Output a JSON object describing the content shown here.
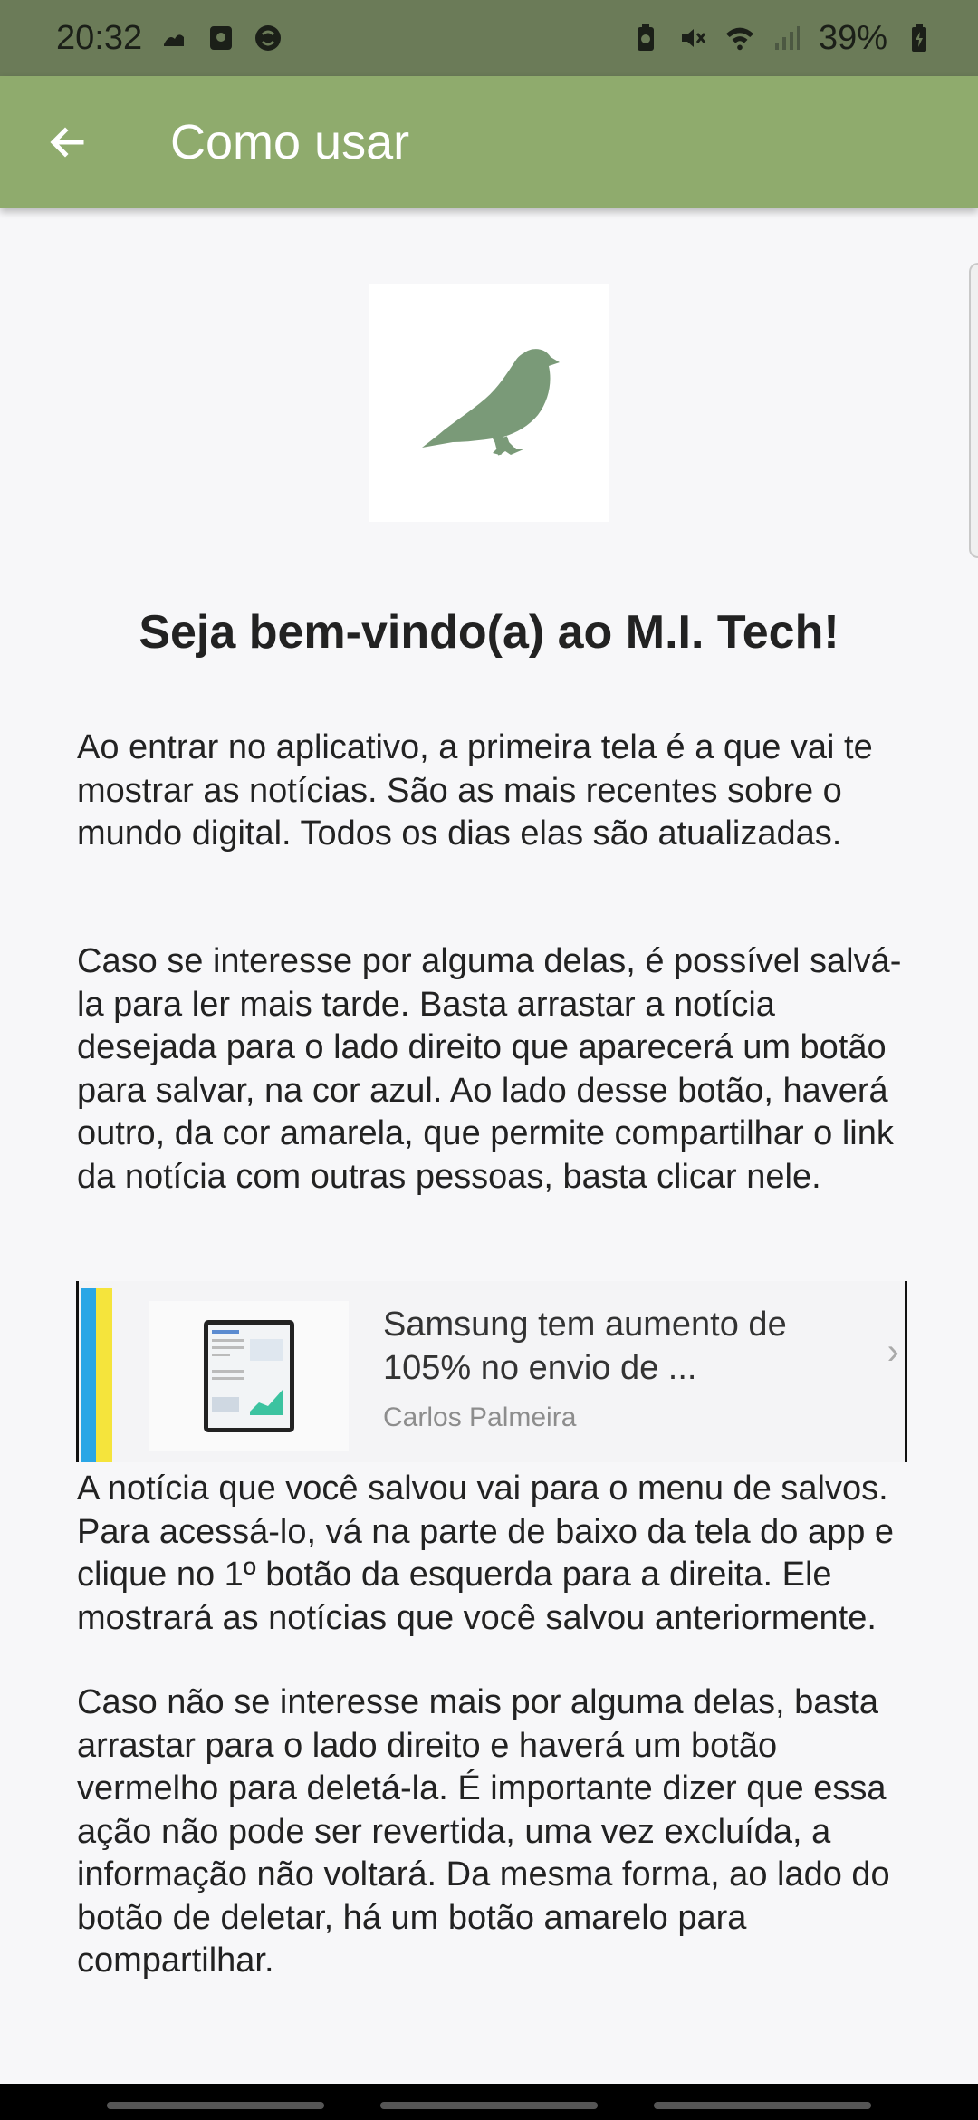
{
  "status_bar": {
    "time": "20:32",
    "battery": "39%",
    "left_icons": [
      "sleep-icon",
      "app-square-icon",
      "sync-icon"
    ],
    "right_icons": [
      "battery-saver-icon",
      "mute-icon",
      "wifi-icon",
      "signal-icon",
      "battery-icon"
    ]
  },
  "app_bar": {
    "title": "Como usar",
    "back_icon": "arrow-left-icon",
    "background": "#8fab6d"
  },
  "logo": {
    "icon": "crow-icon",
    "color": "#7a9a78"
  },
  "content": {
    "welcome_title": "Seja bem-vindo(a) ao M.I. Tech!",
    "paragraph_1": "Ao entrar no aplicativo, a primeira tela é a que vai te mostrar as notícias. São as mais recentes sobre o mundo digital. Todos os dias elas são atualizadas.",
    "paragraph_2": "Caso se interesse por alguma delas, é possível salvá-la para ler mais tarde. Basta arrastar a notícia desejada para o lado direito que aparecerá um botão para salvar, na cor azul. Ao lado desse botão, haverá outro, da cor amarela, que permite compartilhar o link da notícia com outras pessoas, basta clicar nele.",
    "paragraph_3": "A notícia que você salvou vai para o menu de salvos. Para acessá-lo, vá na parte de baixo da tela do app e clique no 1º botão da esquerda para a direita. Ele mostrará as notícias que você salvou anteriormente.",
    "paragraph_4": "Caso não se interesse mais por alguma delas, basta arrastar para o lado direito e haverá um botão vermelho para deletá-la. É importante dizer que essa ação não pode ser revertida, uma vez excluída, a informação não voltará. Da mesma forma, ao lado do botão de deletar, há um botão amarelo para compartilhar."
  },
  "example_card": {
    "headline": "Samsung tem aumento de 105% no envio de ...",
    "author": "Carlos Palmeira",
    "save_color": "#2aa6e6",
    "share_color": "#f5e43c",
    "chevron_icon": "chevron-right-icon"
  }
}
